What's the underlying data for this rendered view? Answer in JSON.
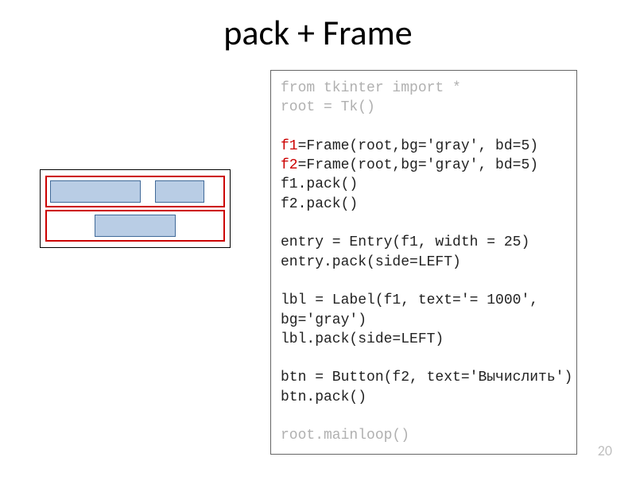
{
  "title": "pack + Frame",
  "page_number": "20",
  "code": {
    "l1": "from tkinter import *",
    "l2": "root = Tk()",
    "l3": "",
    "l4a": "f1",
    "l4b": "=Frame(root,bg='gray', bd=5)",
    "l5a": "f2",
    "l5b": "=Frame(root,bg='gray', bd=5)",
    "l6": "f1.pack()",
    "l7": "f2.pack()",
    "l8": "",
    "l9": "entry = Entry(f1, width = 25)",
    "l10": "entry.pack(side=LEFT)",
    "l11": "",
    "l12": "lbl = Label(f1, text='= 1000',",
    "l13": "bg='gray')",
    "l14": "lbl.pack(side=LEFT)",
    "l15": "",
    "l16": "btn = Button(f2, text='Вычислить')",
    "l17": "btn.pack()",
    "l18": "",
    "l19": "root.mainloop()"
  }
}
